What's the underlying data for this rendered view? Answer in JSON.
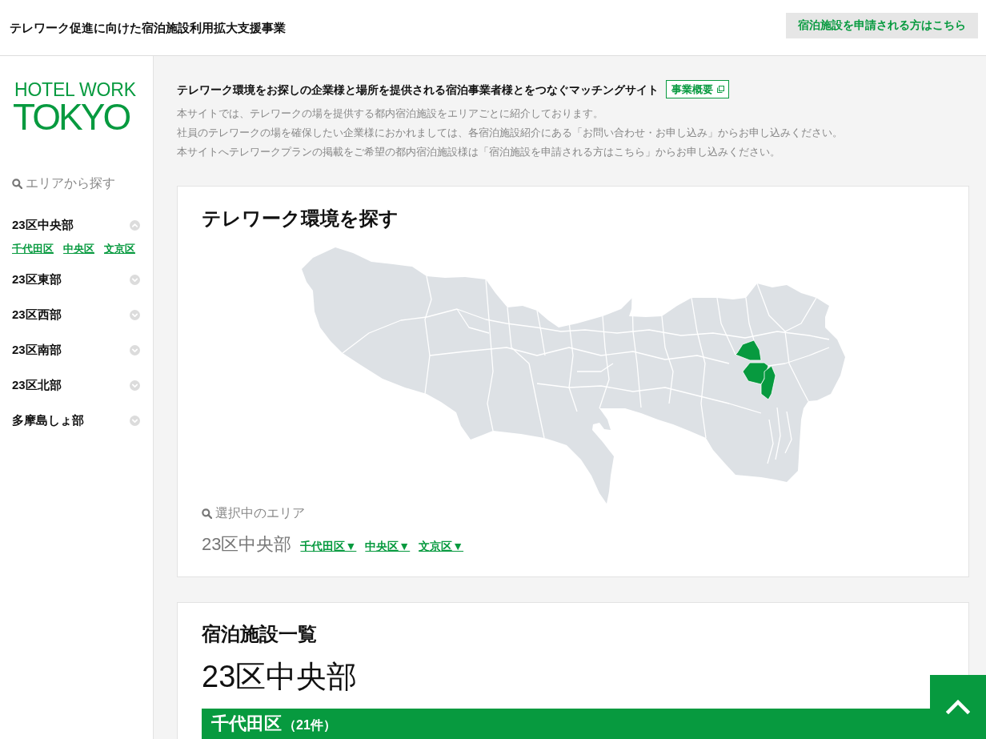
{
  "header": {
    "title": "テレワーク促進に向けた宿泊施設利用拡大支援事業",
    "apply_link": "宿泊施設を申請される方はこちら"
  },
  "sidebar": {
    "logo": {
      "line_1": "HOTEL WORK",
      "line_2": "TOKYO"
    },
    "search_heading": "エリアから探す",
    "areas": [
      {
        "label": "23区中央部",
        "expanded": true,
        "wards": [
          "千代田区",
          "中央区",
          "文京区"
        ]
      },
      {
        "label": "23区東部",
        "expanded": false
      },
      {
        "label": "23区西部",
        "expanded": false
      },
      {
        "label": "23区南部",
        "expanded": false
      },
      {
        "label": "23区北部",
        "expanded": false
      },
      {
        "label": "多摩島しょ部",
        "expanded": false
      }
    ]
  },
  "intro": {
    "heading": "テレワーク環境をお探しの企業様と場所を提供される宿泊事業者様とをつなぐマッチングサイト",
    "overview_link": "事業概要",
    "lines": [
      "本サイトでは、テレワークの場を提供する都内宿泊施設をエリアごとに紹介しております。",
      "社員のテレワークの場を確保したい企業様におかれましては、各宿泊施設紹介にある「お問い合わせ・お申し込み」からお申し込みください。",
      "本サイトへテレワークプランの掲載をご希望の都内宿泊施設様は「宿泊施設を申請される方はこちら」からお申し込みください。"
    ]
  },
  "map_card": {
    "title": "テレワーク環境を探す",
    "selected_label": "選択中のエリア",
    "selected_area": "23区中央部",
    "ward_links": [
      "千代田区▼",
      "中央区▼",
      "文京区▼"
    ]
  },
  "list_card": {
    "title": "宿泊施設一覧",
    "area": "23区中央部",
    "group": {
      "name": "千代田区",
      "count": "（21件）"
    }
  }
}
